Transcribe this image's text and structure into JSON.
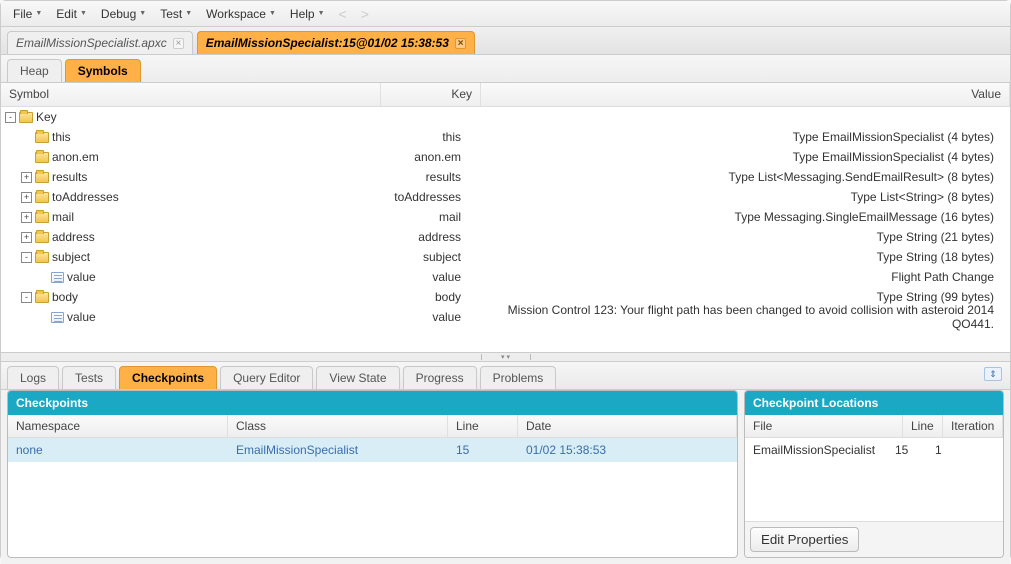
{
  "menubar": {
    "items": [
      "File",
      "Edit",
      "Debug",
      "Test",
      "Workspace",
      "Help"
    ],
    "nav_prev": "<",
    "nav_next": ">"
  },
  "tabs": [
    {
      "label": "EmailMissionSpecialist.apxc",
      "active": false
    },
    {
      "label": "EmailMissionSpecialist:15@01/02 15:38:53",
      "active": true
    }
  ],
  "subtabs": [
    "Heap",
    "Symbols"
  ],
  "subtab_active": "Symbols",
  "grid": {
    "columns": {
      "symbol": "Symbol",
      "key": "Key",
      "value": "Value"
    },
    "rows": [
      {
        "indent": 1,
        "toggle": "-",
        "icon": "folder",
        "symbol": "Key",
        "key": "",
        "value": ""
      },
      {
        "indent": 2,
        "toggle": "",
        "icon": "folder",
        "symbol": "this",
        "key": "this",
        "value": "Type EmailMissionSpecialist (4 bytes)"
      },
      {
        "indent": 2,
        "toggle": "",
        "icon": "folder",
        "symbol": "anon.em",
        "key": "anon.em",
        "value": "Type EmailMissionSpecialist (4 bytes)"
      },
      {
        "indent": 2,
        "toggle": "+",
        "icon": "folder",
        "symbol": "results",
        "key": "results",
        "value": "Type List<Messaging.SendEmailResult> (8 bytes)"
      },
      {
        "indent": 2,
        "toggle": "+",
        "icon": "folder",
        "symbol": "toAddresses",
        "key": "toAddresses",
        "value": "Type List<String> (8 bytes)"
      },
      {
        "indent": 2,
        "toggle": "+",
        "icon": "folder",
        "symbol": "mail",
        "key": "mail",
        "value": "Type Messaging.SingleEmailMessage (16 bytes)"
      },
      {
        "indent": 2,
        "toggle": "+",
        "icon": "folder",
        "symbol": "address",
        "key": "address",
        "value": "Type String (21 bytes)"
      },
      {
        "indent": 2,
        "toggle": "-",
        "icon": "folder",
        "symbol": "subject",
        "key": "subject",
        "value": "Type String (18 bytes)"
      },
      {
        "indent": 3,
        "toggle": "",
        "icon": "leaf",
        "symbol": "value",
        "key": "value",
        "value": "Flight Path Change"
      },
      {
        "indent": 2,
        "toggle": "-",
        "icon": "folder",
        "symbol": "body",
        "key": "body",
        "value": "Type String (99 bytes)"
      },
      {
        "indent": 3,
        "toggle": "",
        "icon": "leaf",
        "symbol": "value",
        "key": "value",
        "value": "Mission Control 123: Your flight path has been changed to avoid collision with asteroid 2014 QO441."
      }
    ]
  },
  "bottom_tabs": [
    "Logs",
    "Tests",
    "Checkpoints",
    "Query Editor",
    "View State",
    "Progress",
    "Problems"
  ],
  "bottom_tab_active": "Checkpoints",
  "checkpoints": {
    "title": "Checkpoints",
    "columns": {
      "ns": "Namespace",
      "class": "Class",
      "line": "Line",
      "date": "Date"
    },
    "rows": [
      {
        "ns": "none",
        "class": "EmailMissionSpecialist",
        "line": "15",
        "date": "01/02 15:38:53"
      }
    ]
  },
  "checkpoint_locations": {
    "title": "Checkpoint Locations",
    "columns": {
      "file": "File",
      "line": "Line",
      "iter": "Iteration"
    },
    "rows": [
      {
        "file": "EmailMissionSpecialist",
        "line": "15",
        "iter": "1"
      }
    ],
    "edit_button": "Edit Properties"
  }
}
